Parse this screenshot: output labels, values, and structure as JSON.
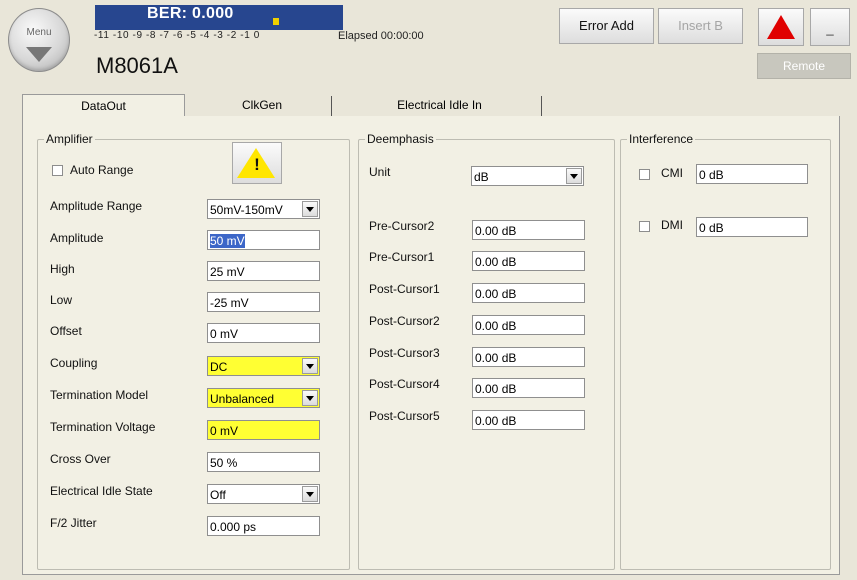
{
  "header": {
    "menu_label": "Menu",
    "ber_text": "BER: 0.000",
    "scale": "-11 -10 -9  -8  -7  -6  -5  -4  -3  -2  -1  0",
    "elapsed": "Elapsed 00:00:00",
    "model": "M8061A",
    "error_add": "Error Add",
    "insert_b": "Insert B",
    "minimize": "_",
    "remote": "Remote"
  },
  "tabs": [
    "DataOut",
    "ClkGen",
    "Electrical Idle In"
  ],
  "amplifier": {
    "title": "Amplifier",
    "auto_range": "Auto Range",
    "amplitude_range": {
      "label": "Amplitude Range",
      "value": "50mV-150mV"
    },
    "amplitude": {
      "label": "Amplitude",
      "value": "50 mV"
    },
    "high": {
      "label": "High",
      "value": "25 mV"
    },
    "low": {
      "label": "Low",
      "value": "-25 mV"
    },
    "offset": {
      "label": "Offset",
      "value": "0 mV"
    },
    "coupling": {
      "label": "Coupling",
      "value": "DC"
    },
    "termination_model": {
      "label": "Termination Model",
      "value": "Unbalanced"
    },
    "termination_voltage": {
      "label": "Termination Voltage",
      "value": "0 mV"
    },
    "cross_over": {
      "label": "Cross Over",
      "value": "50 %"
    },
    "electrical_idle": {
      "label": "Electrical Idle State",
      "value": "Off"
    },
    "f2_jitter": {
      "label": "F/2 Jitter",
      "value": "0.000 ps"
    }
  },
  "deemphasis": {
    "title": "Deemphasis",
    "unit": {
      "label": "Unit",
      "value": "dB"
    },
    "rows": [
      {
        "label": "Pre-Cursor2",
        "value": "0.00 dB"
      },
      {
        "label": "Pre-Cursor1",
        "value": "0.00 dB"
      },
      {
        "label": "Post-Cursor1",
        "value": "0.00 dB"
      },
      {
        "label": "Post-Cursor2",
        "value": "0.00 dB"
      },
      {
        "label": "Post-Cursor3",
        "value": "0.00 dB"
      },
      {
        "label": "Post-Cursor4",
        "value": "0.00 dB"
      },
      {
        "label": "Post-Cursor5",
        "value": "0.00 dB"
      }
    ]
  },
  "interference": {
    "title": "Interference",
    "cmi": {
      "label": "CMI",
      "value": "0 dB"
    },
    "dmi": {
      "label": "DMI",
      "value": "0 dB"
    }
  },
  "colors": {
    "ber_bg": "#27468f",
    "highlight_yellow": "#ffff33",
    "warning_red": "#e00000",
    "panel_bg": "#f2f0e4"
  }
}
